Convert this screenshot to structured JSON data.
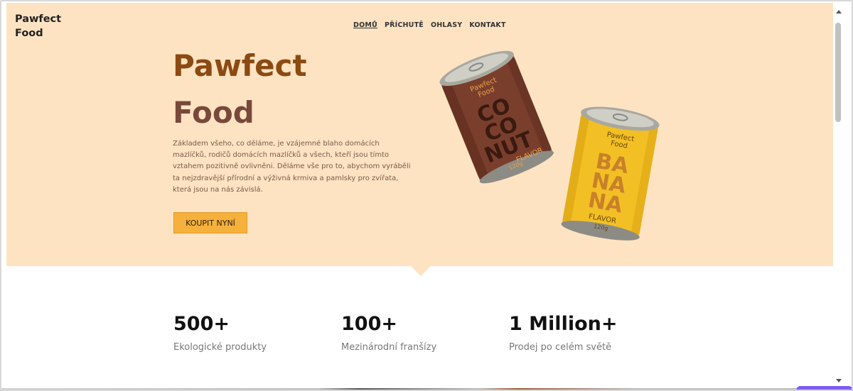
{
  "brand": {
    "line1": "Pawfect",
    "line2": "Food"
  },
  "nav": {
    "items": [
      {
        "label": "DOMŮ",
        "active": true
      },
      {
        "label": "PŘÍCHUTĚ",
        "active": false
      },
      {
        "label": "OHLASY",
        "active": false
      },
      {
        "label": "KONTAKT",
        "active": false
      }
    ]
  },
  "hero": {
    "title_line1": "Pawfect",
    "title_line2": "Food",
    "description": "Základem všeho, co děláme, je vzájemné blaho domácích mazlíčků, rodičů domácích mazlíčků a všech, kteří jsou tímto vztahem pozitivně ovlivněni. Děláme vše pro to, abychom vyráběli ta nejzdravější přírodní a výživná krmiva a pamlsky pro zvířata, která jsou na nás závislá.",
    "cta_label": "KOUPIT NYNÍ"
  },
  "cans": {
    "coconut": {
      "brand_line1": "Pawfect",
      "brand_line2": "Food",
      "flavor_lines": [
        "CO",
        "CO",
        "NUT"
      ],
      "flavor_word": "FLAVOR",
      "weight": "120g",
      "color": "#7a3e2c",
      "text_color": "#3a1a10",
      "accent_text": "#e6a24a"
    },
    "banana": {
      "brand_line1": "Pawfect",
      "brand_line2": "Food",
      "flavor_lines": [
        "BA",
        "NA",
        "NA"
      ],
      "flavor_word": "FLAVOR",
      "weight": "120g",
      "color": "#f2c024",
      "text_color": "#c9802a",
      "accent_text": "#6a4410"
    }
  },
  "stats": [
    {
      "value": "500+",
      "label": "Ekologické produkty"
    },
    {
      "value": "100+",
      "label": "Mezinárodní franšízy"
    },
    {
      "value": "1 Million+",
      "label": "Prodej po celém světě"
    }
  ],
  "colors": {
    "hero_bg": "#fde3c2",
    "title_brown": "#8b4a12",
    "cta_bg": "#f6b13c"
  }
}
